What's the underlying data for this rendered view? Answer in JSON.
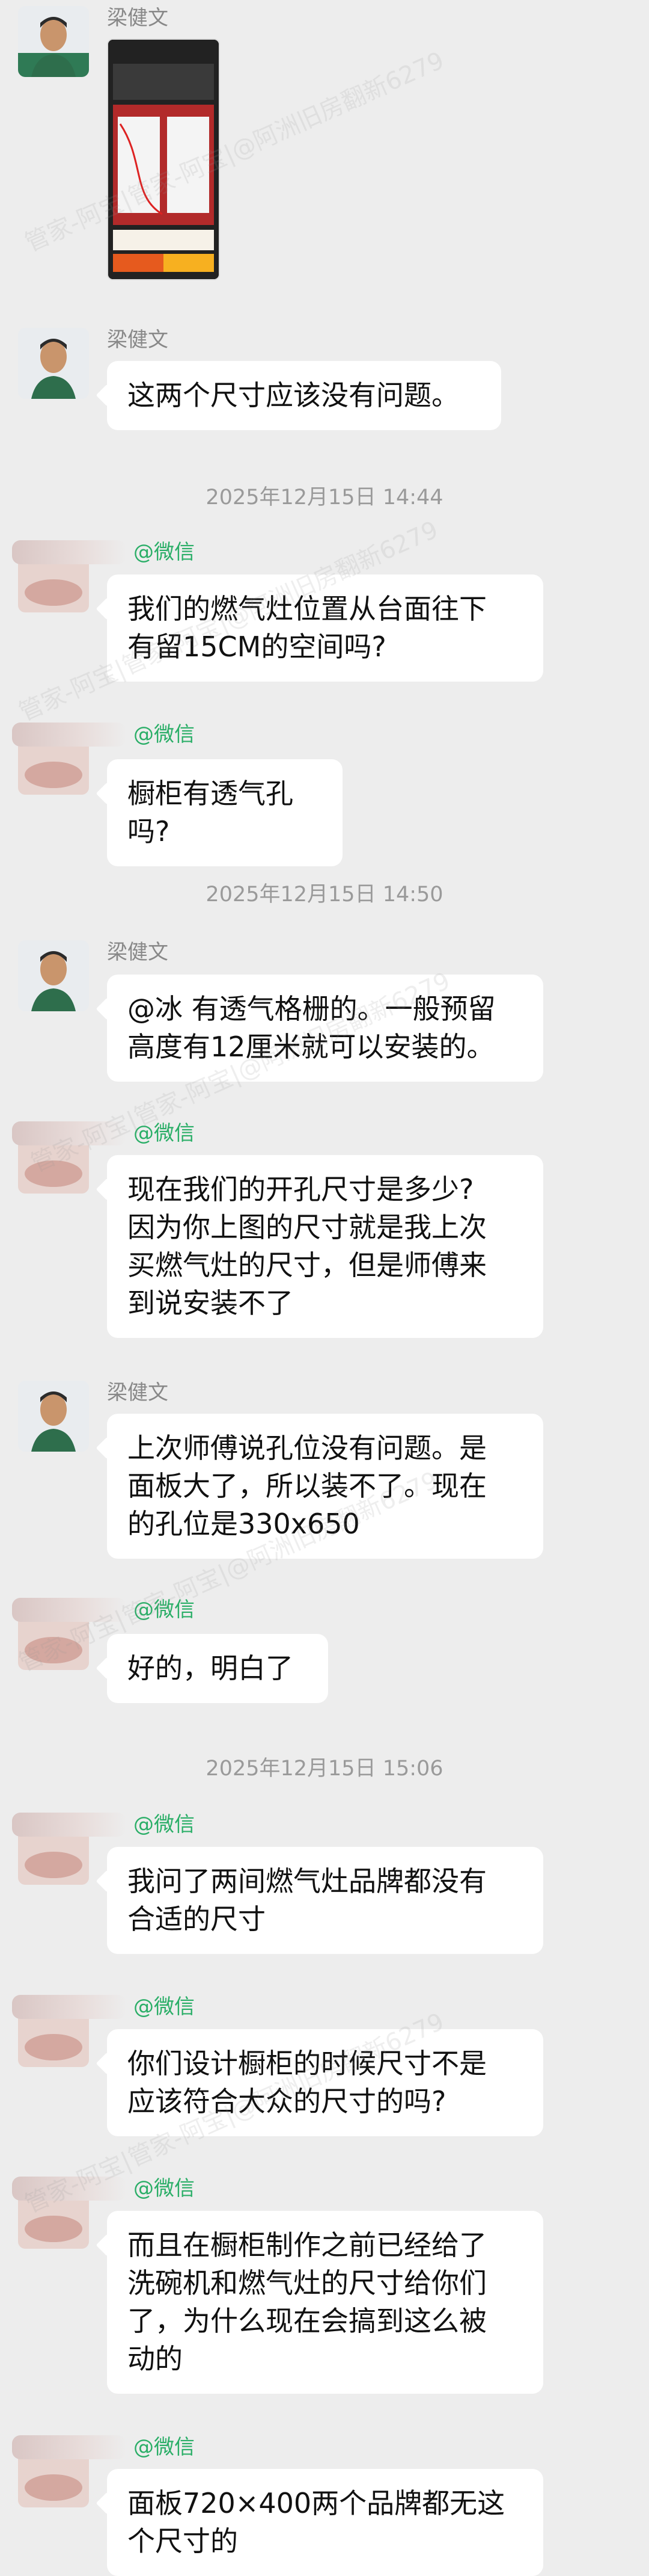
{
  "messages": [
    {
      "kind": "incoming",
      "sender": "梁健文",
      "image": true
    },
    {
      "kind": "incoming",
      "sender": "梁健文",
      "text": "这两个尺寸应该没有问题。"
    },
    {
      "kind": "time",
      "text": "2025年12月15日  14:44"
    },
    {
      "kind": "outgoing-blur",
      "source": "@微信",
      "text": "我们的燃气灶位置从台面往下\n有留15CM的空间吗?"
    },
    {
      "kind": "outgoing-blur",
      "source": "@微信",
      "text": "橱柜有透气孔吗?"
    },
    {
      "kind": "time",
      "text": "2025年12月15日  14:50"
    },
    {
      "kind": "incoming",
      "sender": "梁健文",
      "text": "@冰  有透气格栅的。一般预留\n高度有12厘米就可以安装的。"
    },
    {
      "kind": "outgoing-blur",
      "source": "@微信",
      "text": "现在我们的开孔尺寸是多少?\n因为你上图的尺寸就是我上次\n买燃气灶的尺寸，但是师傅来\n到说安装不了"
    },
    {
      "kind": "incoming",
      "sender": "梁健文",
      "text": "上次师傅说孔位没有问题。是\n面板大了，所以装不了。现在\n的孔位是330x650"
    },
    {
      "kind": "outgoing-blur",
      "source": "@微信",
      "text": "好的，明白了"
    },
    {
      "kind": "time",
      "text": "2025年12月15日  15:06"
    },
    {
      "kind": "outgoing-blur",
      "source": "@微信",
      "text": "我问了两间燃气灶品牌都没有\n合适的尺寸"
    },
    {
      "kind": "outgoing-blur",
      "source": "@微信",
      "text": "你们设计橱柜的时候尺寸不是\n应该符合大众的尺寸的吗?"
    },
    {
      "kind": "outgoing-blur",
      "source": "@微信",
      "text": "而且在橱柜制作之前已经给了\n洗碗机和燃气灶的尺寸给你们\n了，为什么现在会搞到这么被\n动的"
    },
    {
      "kind": "outgoing-blur",
      "source": "@微信",
      "text": "面板720×400两个品牌都无这\n个尺寸的"
    }
  ],
  "watermark": "管家-阿宝|管家-阿宝|@阿洲旧房翻新6279",
  "colors": {
    "background": "#ededed",
    "bubble": "#ffffff",
    "source": "#2aae67",
    "time": "#9a9a9a"
  },
  "icons": {
    "avatar_person": "person-avatar-icon",
    "avatar_blurred": "blurred-avatar-icon"
  }
}
